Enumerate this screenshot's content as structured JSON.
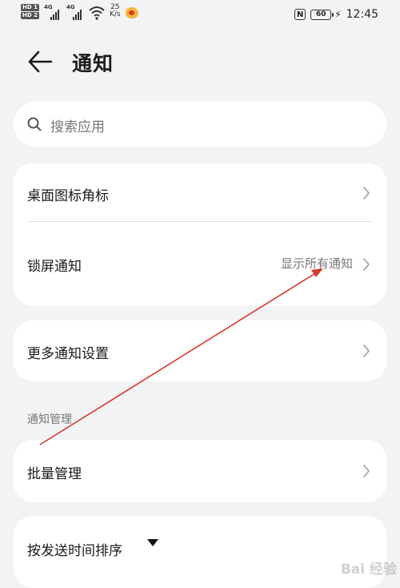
{
  "status_bar": {
    "hd1": "HD 1",
    "hd2": "HD 2",
    "sig1": "4G",
    "sig2": "4G",
    "speed_value": "25",
    "speed_unit": "K/s",
    "battery": "60",
    "time": "12:45",
    "icons": [
      "hd-icon",
      "signal-icon",
      "wifi-icon",
      "weibo-icon",
      "nfc-icon",
      "battery-icon",
      "charging-icon"
    ]
  },
  "header": {
    "title": "通知",
    "back_icon": "arrow-left-icon"
  },
  "search": {
    "placeholder": "搜索应用",
    "icon": "search-icon"
  },
  "group1": {
    "items": [
      {
        "label": "桌面图标角标",
        "value": ""
      },
      {
        "label": "锁屏通知",
        "value": "显示所有通知"
      }
    ]
  },
  "group2": {
    "items": [
      {
        "label": "更多通知设置"
      }
    ]
  },
  "section": {
    "title": "通知管理"
  },
  "group3": {
    "items": [
      {
        "label": "批量管理"
      }
    ]
  },
  "group4": {
    "sort_label": "按发送时间排序",
    "sort_icon": "triangle-down-icon"
  },
  "watermark": "Bai 经验",
  "colors": {
    "background": "#f1f3f5",
    "card": "#ffffff",
    "annotation_arrow": "#d9362b",
    "secondary_text": "#777777"
  }
}
